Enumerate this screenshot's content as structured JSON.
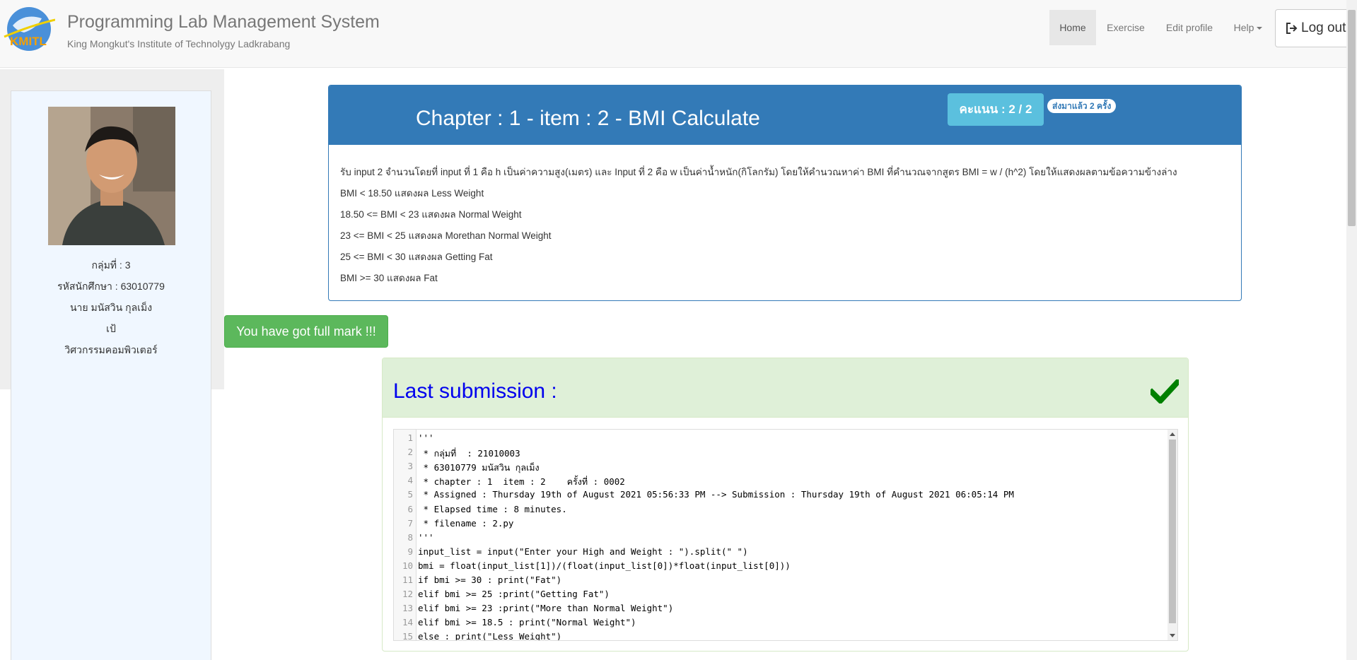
{
  "header": {
    "title": "Programming Lab Management System",
    "subtitle": "King Mongkut's Institute of Technolygy Ladkrabang",
    "logo_text": "KMITL",
    "nav": {
      "home": "Home",
      "exercise": "Exercise",
      "edit_profile": "Edit profile",
      "help": "Help",
      "logout": "Log out"
    }
  },
  "profile": {
    "group": "กลุ่มที่ : 3",
    "student_id": "รหัสนักศึกษา : 63010779",
    "name": "นาย มนัสวิน กุลเม็ง",
    "nickname": "เป้",
    "department": "วิศวกรรมคอมพิวเตอร์"
  },
  "exercise": {
    "title": "Chapter : 1 - item : 2 - BMI Calculate",
    "score": "คะแนน : 2 / 2",
    "times": "ส่งมาแล้ว 2 ครั้ง",
    "description": [
      "รับ input 2 จำนวนโดยที่ input ที่ 1 คือ h เป็นค่าความสูง(เมตร) และ Input ที่ 2 คือ w เป็นค่าน้ำหนัก(กิโลกรัม) โดยให้คำนวณหาค่า BMI ที่คำนวณจากสูตร BMI = w / (h^2) โดยให้แสดงผลตามข้อความข้างล่าง",
      "BMI < 18.50 แสดงผล Less Weight",
      "18.50 <= BMI  < 23 แสดงผล Normal Weight",
      "23 <= BMI  < 25 แสดงผล Morethan Normal Weight",
      "25 <= BMI  < 30 แสดงผล Getting Fat",
      "BMI  >= 30 แสดงผล Fat"
    ]
  },
  "alert": {
    "full_mark": "You have got full mark !!!"
  },
  "submission": {
    "title": "Last submission :",
    "check_icon": "check-icon",
    "code": [
      "'''",
      " * กลุ่มที่  : 21010003",
      " * 63010779 มนัสวิน กุลเม็ง",
      " * chapter : 1  item : 2    ครั้งที่ : 0002",
      " * Assigned : Thursday 19th of August 2021 05:56:33 PM --> Submission : Thursday 19th of August 2021 06:05:14 PM",
      " * Elapsed time : 8 minutes.",
      " * filename : 2.py",
      "'''",
      "input_list = input(\"Enter your High and Weight : \").split(\" \")",
      "bmi = float(input_list[1])/(float(input_list[0])*float(input_list[0]))",
      "if bmi >= 30 : print(\"Fat\")",
      "elif bmi >= 25 :print(\"Getting Fat\")",
      "elif bmi >= 23 :print(\"More than Normal Weight\")",
      "elif bmi >= 18.5 : print(\"Normal Weight\")",
      "else : print(\"Less Weight\")"
    ]
  }
}
